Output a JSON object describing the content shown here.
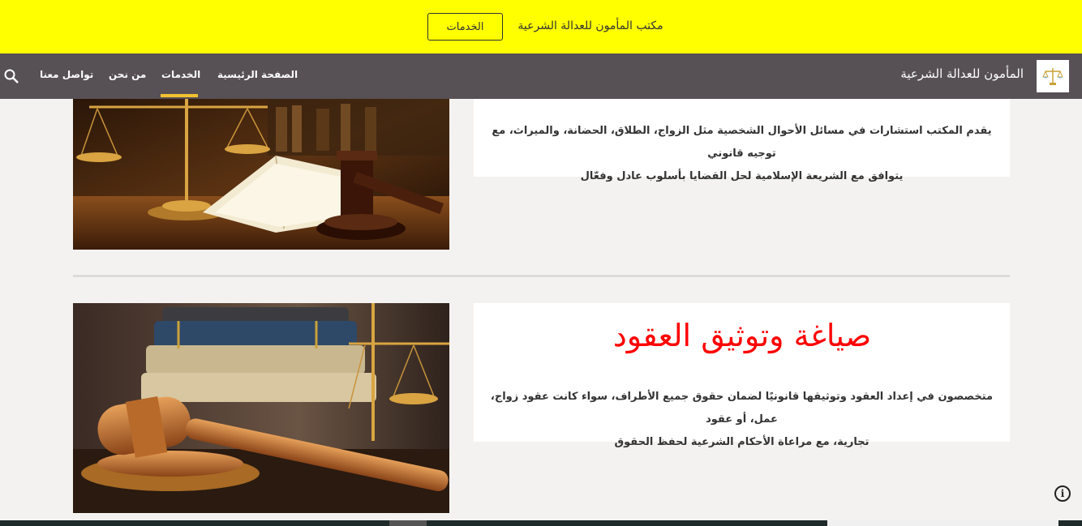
{
  "banner": {
    "text": "مكتب المأمون للعدالة الشرعية",
    "button_label": "الخدمات",
    "bg_color": "#ffff00"
  },
  "navbar": {
    "site_title": "المأمون للعدالة الشرعية",
    "items": [
      {
        "label": "الصفحة الرئيسية",
        "active": false
      },
      {
        "label": "الخدمات",
        "active": true
      },
      {
        "label": "من نحن",
        "active": false
      },
      {
        "label": "تواصل معنا",
        "active": false
      }
    ],
    "bg_color": "#575055",
    "active_color": "#f2c230",
    "search_icon": "search-icon",
    "logo_icon": "scales-logo"
  },
  "services": [
    {
      "title": "",
      "description_lines": [
        "يقدم المكتب استشارات في مسائل الأحوال الشخصية مثل الزواج، الطلاق، الحضانة، والميراث، مع توجيه قانوني",
        "يتوافق مع الشريعة الإسلامية لحل القضايا بأسلوب عادل وفعّال"
      ],
      "image": "scales-book-gavel-photo"
    },
    {
      "title": "صياغة وتوثيق العقود",
      "description_lines": [
        "متخصصون في إعداد العقود وتوثيقها قانونيًا لضمان حقوق جميع الأطراف، سواء كانت عقود زواج، عمل، أو عقود",
        "تجارية، مع مراعاة الأحكام الشرعية لحفظ الحقوق"
      ],
      "image": "gavel-books-scales-photo",
      "title_color": "#ff0000"
    }
  ],
  "info_icon": "info-icon"
}
